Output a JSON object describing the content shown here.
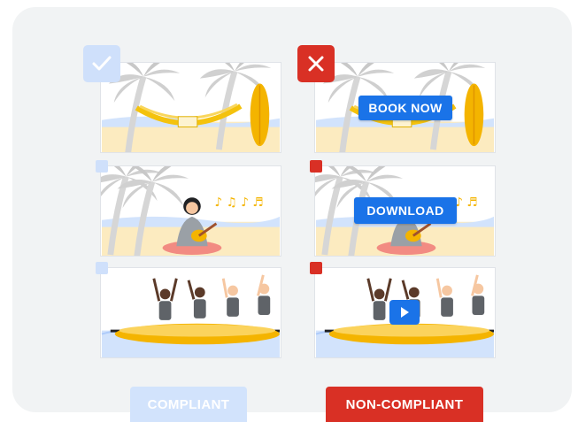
{
  "colors": {
    "compliant": "#cfe0fb",
    "non_compliant": "#d93025",
    "button_blue": "#1a73e8",
    "card_bg": "#f1f3f4"
  },
  "icons": {
    "compliant": "checkmark-icon",
    "non_compliant": "cross-icon",
    "play": "play-icon"
  },
  "columns": {
    "compliant": {
      "label": "COMPLIANT",
      "rows": [
        "beach-hammock",
        "ukulele-player",
        "banana-boat"
      ]
    },
    "non_compliant": {
      "label": "NON-COMPLIANT",
      "overlays": {
        "row1": "BOOK NOW",
        "row2": "DOWNLOAD",
        "row3": "play-button"
      }
    }
  }
}
